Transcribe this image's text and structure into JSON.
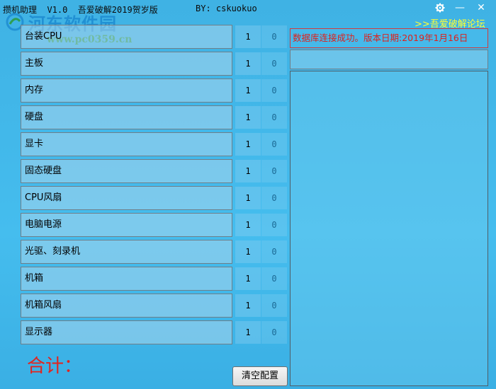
{
  "window": {
    "title": "攒机助理  V1.0  吾爱破解2019贺岁版",
    "author": "BY: cskuokuo",
    "settings_icon": "gear-icon",
    "minimize_label": "—",
    "close_label": "✕"
  },
  "watermark": {
    "text": "河东软件园",
    "url": "www.pc0359.cn"
  },
  "header": {
    "forum_link": ">>吾爱破解论坛"
  },
  "parts": [
    {
      "label": "台装CPU",
      "qty": "1",
      "price": "0"
    },
    {
      "label": "主板",
      "qty": "1",
      "price": "0"
    },
    {
      "label": "内存",
      "qty": "1",
      "price": "0"
    },
    {
      "label": "硬盘",
      "qty": "1",
      "price": "0"
    },
    {
      "label": "显卡",
      "qty": "1",
      "price": "0"
    },
    {
      "label": "固态硬盘",
      "qty": "1",
      "price": "0"
    },
    {
      "label": "CPU风扇",
      "qty": "1",
      "price": "0"
    },
    {
      "label": "电脑电源",
      "qty": "1",
      "price": "0"
    },
    {
      "label": "光驱、刻录机",
      "qty": "1",
      "price": "0"
    },
    {
      "label": "机箱",
      "qty": "1",
      "price": "0"
    },
    {
      "label": "机箱风扇",
      "qty": "1",
      "price": "0"
    },
    {
      "label": "显示器",
      "qty": "1",
      "price": "0"
    }
  ],
  "footer": {
    "total_label": "合计：",
    "clear_button": "清空配置"
  },
  "right_panel": {
    "status": "数据库连接成功。版本日期:2019年1月16日"
  },
  "colors": {
    "background": "#42b8ea",
    "status_text": "#e0201a",
    "total_text": "#e3231d",
    "forum_link": "#ffff33"
  }
}
